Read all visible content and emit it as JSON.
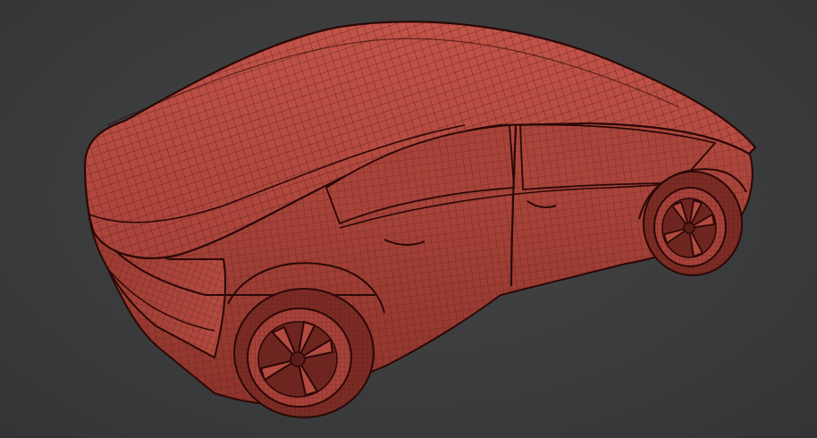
{
  "scene": {
    "subject": "car-wireframe-model",
    "colors": {
      "background": "#3a3b3c",
      "body_fill": "#b5483f",
      "body_shadow": "#7a2a24",
      "body_highlight": "#c8594e",
      "wire": "#3d0f0c",
      "outline": "#2a0806"
    }
  }
}
